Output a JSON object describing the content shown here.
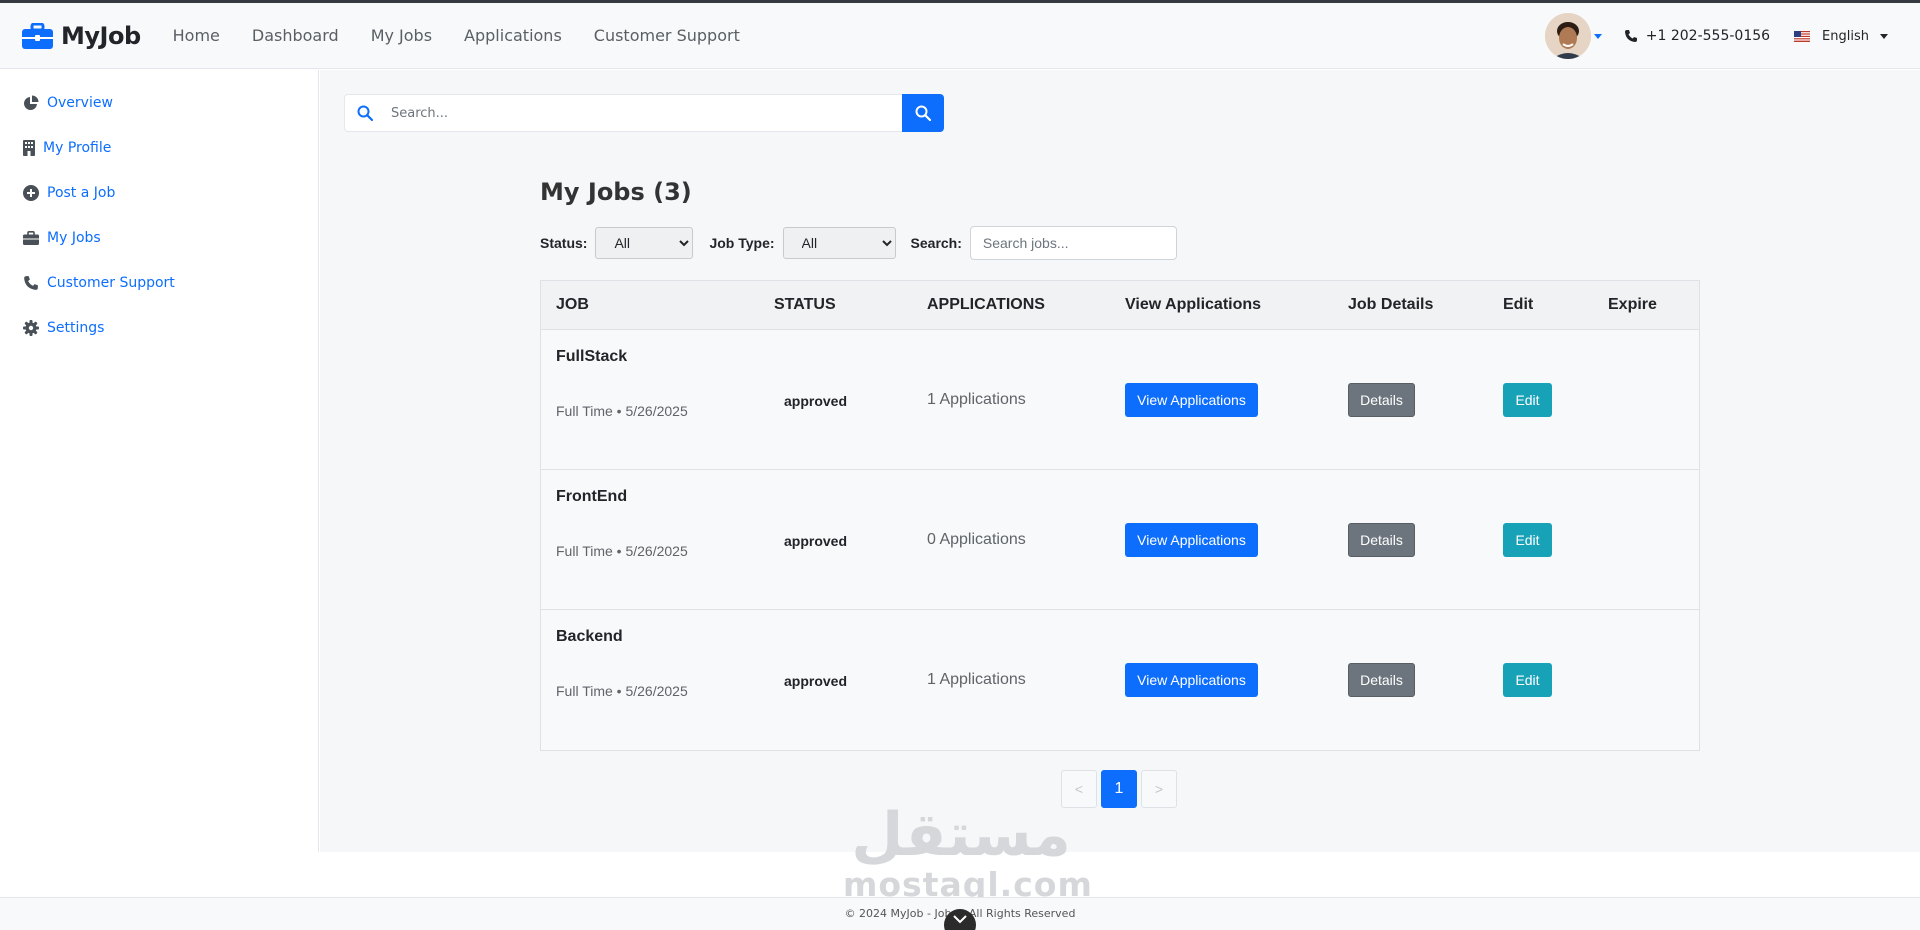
{
  "brand": {
    "name": "MyJob"
  },
  "nav": [
    "Home",
    "Dashboard",
    "My Jobs",
    "Applications",
    "Customer Support"
  ],
  "header": {
    "phone": "+1 202-555-0156",
    "language": "English"
  },
  "sidebar": {
    "items": [
      {
        "label": "Overview",
        "icon": "pie-chart-icon"
      },
      {
        "label": "My Profile",
        "icon": "building-icon"
      },
      {
        "label": "Post a Job",
        "icon": "plus-circle-icon"
      },
      {
        "label": "My Jobs",
        "icon": "briefcase-icon"
      },
      {
        "label": "Customer Support",
        "icon": "phone-icon"
      },
      {
        "label": "Settings",
        "icon": "gear-icon"
      }
    ]
  },
  "search": {
    "placeholder": "Search..."
  },
  "page": {
    "title": "My Jobs (3)"
  },
  "filters": {
    "status_label": "Status:",
    "status_value": "All",
    "jobtype_label": "Job Type:",
    "jobtype_value": "All",
    "search_label": "Search:",
    "search_placeholder": "Search jobs..."
  },
  "table": {
    "headers": [
      "JOB",
      "STATUS",
      "APPLICATIONS",
      "View Applications",
      "Job Details",
      "Edit",
      "Expire"
    ],
    "rows": [
      {
        "title": "FullStack",
        "meta": "Full Time • 5/26/2025",
        "status": "approved",
        "applications": "1 Applications",
        "view_label": "View Applications",
        "details_label": "Details",
        "edit_label": "Edit"
      },
      {
        "title": "FrontEnd",
        "meta": "Full Time • 5/26/2025",
        "status": "approved",
        "applications": "0 Applications",
        "view_label": "View Applications",
        "details_label": "Details",
        "edit_label": "Edit"
      },
      {
        "title": "Backend",
        "meta": "Full Time • 5/26/2025",
        "status": "approved",
        "applications": "1 Applications",
        "view_label": "View Applications",
        "details_label": "Details",
        "edit_label": "Edit"
      }
    ]
  },
  "pagination": {
    "prev": "<",
    "current": "1",
    "next": ">"
  },
  "watermark": {
    "arabic": "مستقل",
    "latin": "mostaql.com"
  },
  "footer": {
    "text": "© 2024 MyJob - Job ... All Rights Reserved"
  },
  "colors": {
    "primary": "#0d6efd",
    "secondary": "#6c757d",
    "info": "#17a2b8"
  }
}
